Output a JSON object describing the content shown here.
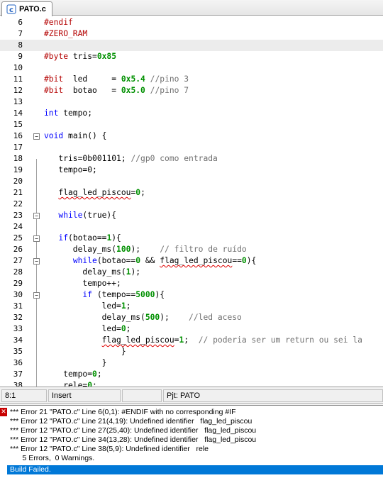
{
  "tab": {
    "label": "PATO.c",
    "icon": "c-file-icon"
  },
  "code": {
    "l6": {
      "n": "6",
      "a": "#endif"
    },
    "l7": {
      "n": "7",
      "a": "#ZERO_RAM"
    },
    "l8": {
      "n": "8"
    },
    "l9": {
      "n": "9",
      "a": "#byte",
      "b": " tris=",
      "c": "0x85"
    },
    "l10": {
      "n": "10"
    },
    "l11": {
      "n": "11",
      "a": "#bit",
      "b": "  led     = ",
      "c": "0x5.4",
      "d": " //pino 3"
    },
    "l12": {
      "n": "12",
      "a": "#bit",
      "b": "  botao   = ",
      "c": "0x5.0",
      "d": " //pino 7"
    },
    "l13": {
      "n": "13"
    },
    "l14": {
      "n": "14",
      "a": "int",
      "b": " tempo;"
    },
    "l15": {
      "n": "15"
    },
    "l16": {
      "n": "16",
      "a": "void",
      "b": " main() {"
    },
    "l17": {
      "n": "17"
    },
    "l18": {
      "n": "18",
      "a": "   tris=0b001101; ",
      "b": "//gp0 como entrada"
    },
    "l19": {
      "n": "19",
      "a": "   tempo=",
      "b": "0",
      "c": ";"
    },
    "l20": {
      "n": "20"
    },
    "l21": {
      "n": "21",
      "a": "   ",
      "b": "flag_led_piscou",
      "c": "=",
      "d": "0",
      "e": ";"
    },
    "l22": {
      "n": "22"
    },
    "l23": {
      "n": "23",
      "a": "   ",
      "b": "while",
      "c": "(true){"
    },
    "l24": {
      "n": "24"
    },
    "l25": {
      "n": "25",
      "a": "   ",
      "b": "if",
      "c": "(botao==",
      "d": "1",
      "e": "){"
    },
    "l26": {
      "n": "26",
      "a": "      delay_ms(",
      "b": "100",
      "c": ");    ",
      "d": "// filtro de ruído"
    },
    "l27": {
      "n": "27",
      "a": "      ",
      "b": "while",
      "c": "(botao==",
      "d": "0",
      "e": " && ",
      "f": "flag_led_piscou",
      "g": "==",
      "h": "0",
      "i": "){"
    },
    "l28": {
      "n": "28",
      "a": "        delay_ms(",
      "b": "1",
      "c": ");"
    },
    "l29": {
      "n": "29",
      "a": "        tempo++;"
    },
    "l30": {
      "n": "30",
      "a": "        ",
      "b": "if",
      "c": " (tempo==",
      "d": "5000",
      "e": "){"
    },
    "l31": {
      "n": "31",
      "a": "            led=",
      "b": "1",
      "c": ";"
    },
    "l32": {
      "n": "32",
      "a": "            delay_ms(",
      "b": "500",
      "c": ");    ",
      "d": "//led aceso"
    },
    "l33": {
      "n": "33",
      "a": "            led=",
      "b": "0",
      "c": ";"
    },
    "l34": {
      "n": "34",
      "a": "            ",
      "b": "flag_led_piscou",
      "c": "=",
      "d": "1",
      "e": ";  ",
      "f": "// poderia ser um return ou sei la"
    },
    "l35": {
      "n": "35",
      "a": "                }"
    },
    "l36": {
      "n": "36",
      "a": "            }"
    },
    "l37": {
      "n": "37",
      "a": "    tempo=",
      "b": "0",
      "c": ";"
    },
    "l38": {
      "n": "38",
      "a": "    rele=",
      "b": "0",
      "c": ";"
    }
  },
  "status": {
    "position": "8:1",
    "mode": "Insert",
    "project": "Pjt: PATO"
  },
  "output": {
    "lines": [
      "*** Error 21 \"PATO.c\" Line 6(0,1): #ENDIF with no corresponding #IF",
      "*** Error 12 \"PATO.c\" Line 21(4,19): Undefined identifier   flag_led_piscou",
      "*** Error 12 \"PATO.c\" Line 27(25,40): Undefined identifier   flag_led_piscou",
      "*** Error 12 \"PATO.c\" Line 34(13,28): Undefined identifier   flag_led_piscou",
      "*** Error 12 \"PATO.c\" Line 38(5,9): Undefined identifier   rele",
      "      5 Errors,  0 Warnings."
    ],
    "result": "Build Failed."
  },
  "colors": {
    "keyword": "#0000ff",
    "preprocessor": "#b40000",
    "number": "#009000",
    "comment": "#707070",
    "selection": "#0078d7"
  }
}
